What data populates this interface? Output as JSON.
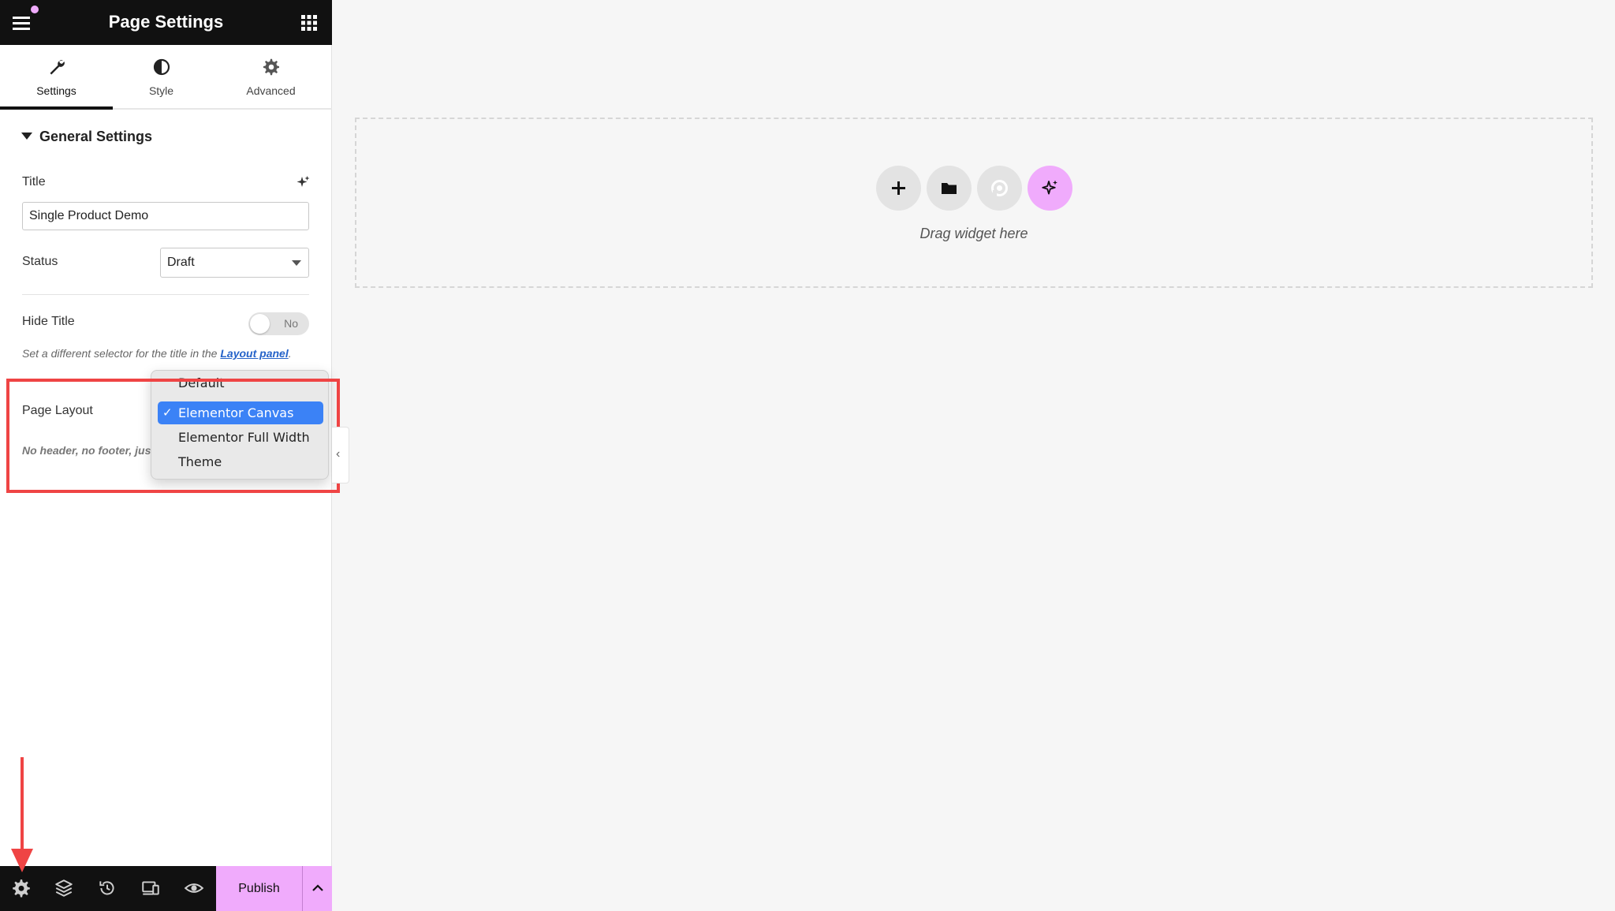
{
  "header": {
    "title": "Page Settings"
  },
  "tabs": [
    {
      "label": "Settings",
      "icon": "wrench-icon",
      "active": true
    },
    {
      "label": "Style",
      "icon": "half-circle-icon",
      "active": false
    },
    {
      "label": "Advanced",
      "icon": "gear-icon",
      "active": false
    }
  ],
  "general_settings": {
    "section_title": "General Settings",
    "title_label": "Title",
    "title_value": "Single Product Demo",
    "status_label": "Status",
    "status_value": "Draft",
    "hide_title_label": "Hide Title",
    "hide_title_toggle": "No",
    "help_text_prefix": "Set a different selector for the title in the ",
    "help_text_link": "Layout panel",
    "help_text_suffix": ".",
    "page_layout_label": "Page Layout",
    "page_layout_description": "No header, no footer, just Elementor"
  },
  "page_layout_dropdown": {
    "selected": "Elementor Canvas",
    "options": [
      "Default",
      "Elementor Canvas",
      "Elementor Full Width",
      "Theme"
    ]
  },
  "canvas": {
    "drop_text": "Drag widget here"
  },
  "bottom_bar": {
    "publish_label": "Publish"
  },
  "colors": {
    "accent_pink": "#f0abfc",
    "annotation_red": "#ef4444",
    "selection_blue": "#3b82f6",
    "dark_bar": "#111111"
  }
}
